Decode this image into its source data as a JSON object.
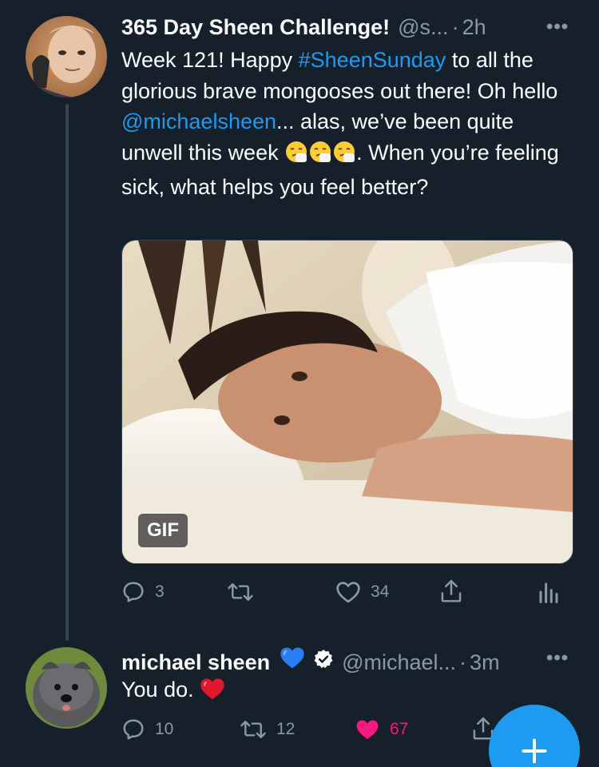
{
  "tweet1": {
    "display_name": "365 Day Sheen Challenge!",
    "handle": "@s...",
    "separator": "·",
    "time": "2h",
    "more": "•••",
    "text_parts": {
      "p1": "Week 121! Happy ",
      "hashtag": "#SheenSunday",
      "p2": " to all the glorious brave mongooses out there! Oh hello ",
      "mention": "@michaelsheen",
      "p3": "... alas, we’ve been quite unwell this week ",
      "p4": ". When you’re feeling sick, what helps you feel better?"
    },
    "emoji": "sneezing-face",
    "media_badge": "GIF",
    "actions": {
      "replies": "3",
      "retweets": "",
      "likes": "34"
    }
  },
  "tweet2": {
    "display_name": "michael sheen",
    "handle": "@michael...",
    "separator": "·",
    "time": "3m",
    "more": "•••",
    "text": "You do. ",
    "emoji": "red-heart",
    "actions": {
      "replies": "10",
      "retweets": "12",
      "likes": "67"
    }
  },
  "colors": {
    "background": "#15202b",
    "accent": "#1d9bf0",
    "muted": "#8b98a5",
    "like_pink": "#f91880"
  },
  "icons": [
    "reply-icon",
    "retweet-icon",
    "like-icon",
    "share-icon",
    "analytics-icon",
    "verified-icon",
    "compose-icon"
  ]
}
